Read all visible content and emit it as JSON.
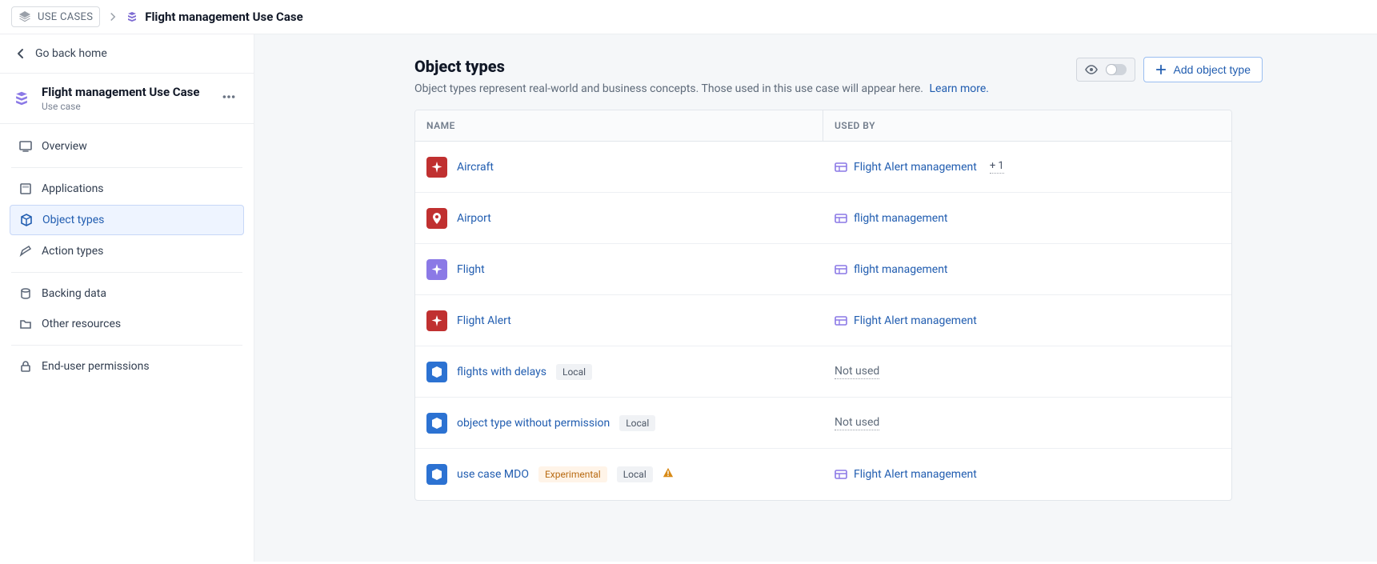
{
  "breadcrumb": {
    "root": "USE CASES",
    "current": "Flight management Use Case"
  },
  "back": "Go back home",
  "use_case": {
    "title": "Flight management Use Case",
    "subtitle": "Use case"
  },
  "nav": {
    "overview": "Overview",
    "applications": "Applications",
    "object_types": "Object types",
    "action_types": "Action types",
    "backing_data": "Backing data",
    "other_resources": "Other resources",
    "end_user_permissions": "End-user permissions"
  },
  "page": {
    "title": "Object types",
    "description": "Object types represent real-world and business concepts. Those used in this use case will appear here.",
    "learn_more": "Learn more.",
    "add_button": "Add object type"
  },
  "table": {
    "headers": {
      "name": "NAME",
      "used_by": "USED BY"
    },
    "tags": {
      "local": "Local",
      "experimental": "Experimental"
    },
    "not_used": "Not used",
    "rows": [
      {
        "name": "Aircraft",
        "icon": "airplane",
        "color": "red",
        "used": [
          {
            "label": "Flight Alert management",
            "extra": "+ 1"
          }
        ]
      },
      {
        "name": "Airport",
        "icon": "pin",
        "color": "red",
        "used": [
          {
            "label": "flight management"
          }
        ]
      },
      {
        "name": "Flight",
        "icon": "airplane",
        "color": "purple",
        "used": [
          {
            "label": "flight management"
          }
        ]
      },
      {
        "name": "Flight Alert",
        "icon": "airplane",
        "color": "red",
        "used": [
          {
            "label": "Flight Alert management"
          }
        ]
      },
      {
        "name": "flights with delays",
        "icon": "cube",
        "color": "blue",
        "tags": [
          "local"
        ],
        "used": []
      },
      {
        "name": "object type without permission",
        "icon": "cube",
        "color": "blue",
        "tags": [
          "local"
        ],
        "used": []
      },
      {
        "name": "use case MDO",
        "icon": "cube",
        "color": "blue",
        "tags": [
          "experimental",
          "local"
        ],
        "warn": true,
        "used": [
          {
            "label": "Flight Alert management"
          }
        ]
      }
    ]
  }
}
